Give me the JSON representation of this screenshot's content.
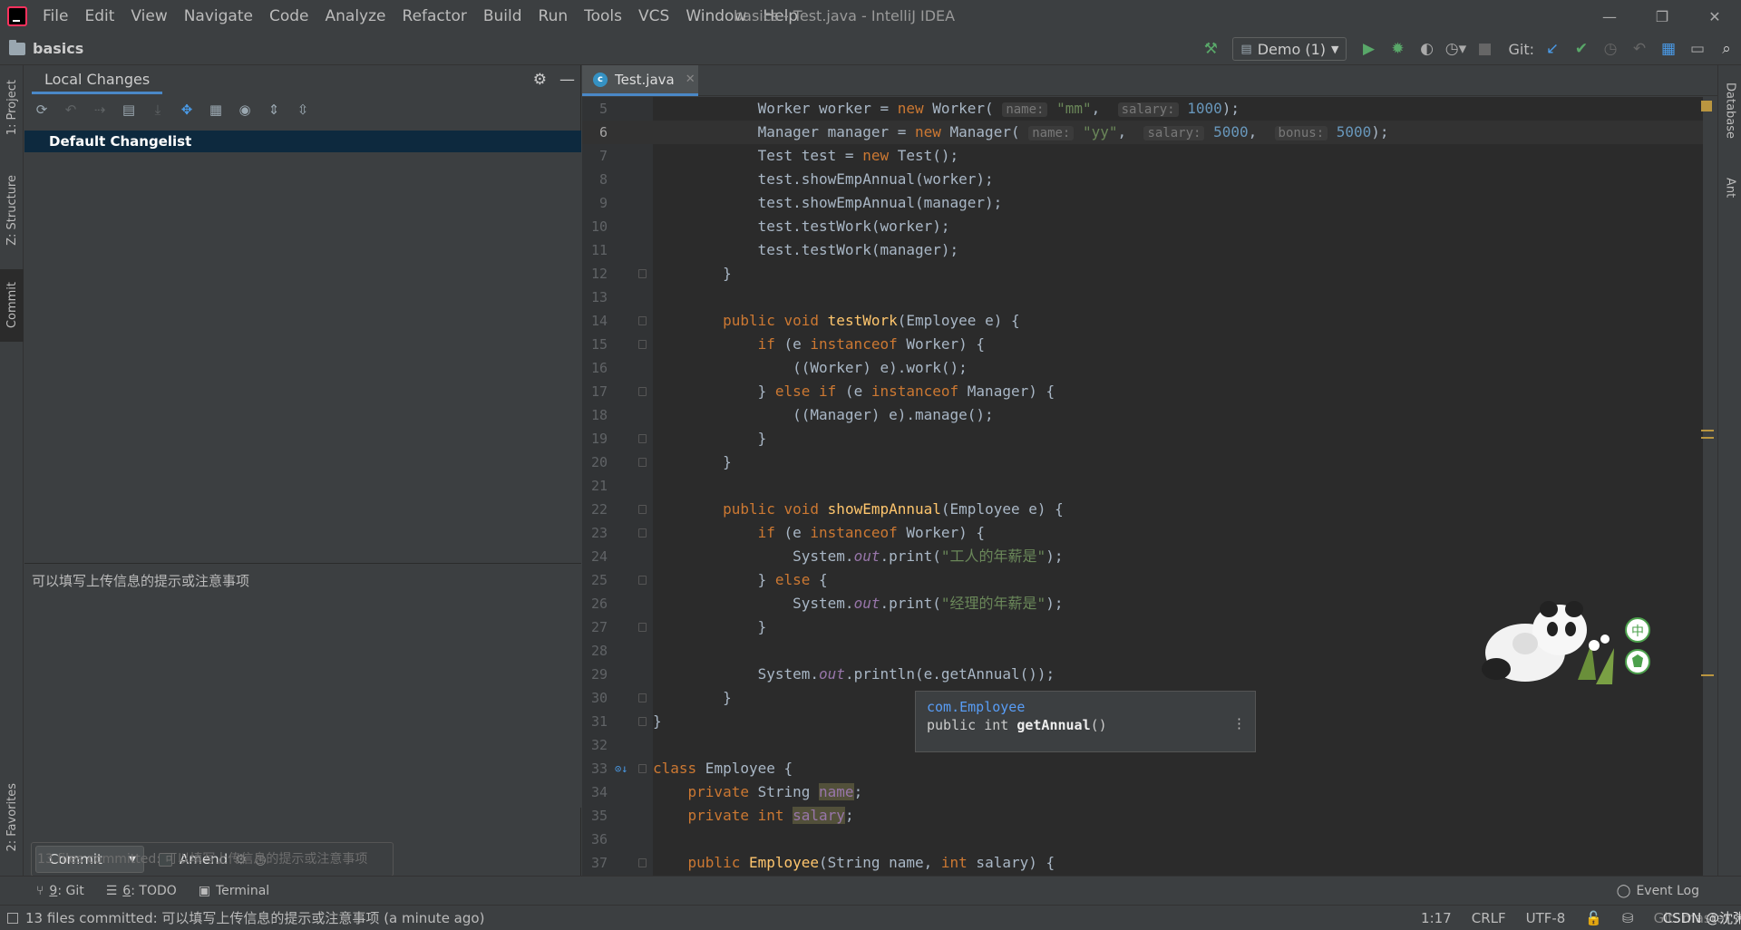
{
  "window": {
    "title": "basics - Test.java - IntelliJ IDEA",
    "menu": [
      "File",
      "Edit",
      "View",
      "Navigate",
      "Code",
      "Analyze",
      "Refactor",
      "Build",
      "Run",
      "Tools",
      "VCS",
      "Window",
      "Help"
    ]
  },
  "navbar": {
    "project": "basics",
    "run_config": "Demo (1)",
    "git_label": "Git:"
  },
  "left_stripe": {
    "project": "1: Project",
    "structure": "Z: Structure",
    "commit": "Commit",
    "favorites": "2: Favorites"
  },
  "right_stripe": {
    "database": "Database",
    "ant": "Ant"
  },
  "tool_window": {
    "tab": "Local Changes",
    "changelist": "Default Changelist",
    "commit_message": "可以填写上传信息的提示或注意事项",
    "commit_button": "Commit",
    "amend_label": "Amend",
    "ghost_text": "13 files committed: 可以填写上传信息的提示或注意事项"
  },
  "editor": {
    "tab": "Test.java",
    "lines": [
      5,
      6,
      7,
      8,
      9,
      10,
      11,
      12,
      13,
      14,
      15,
      16,
      17,
      18,
      19,
      20,
      21,
      22,
      23,
      24,
      25,
      26,
      27,
      28,
      29,
      30,
      31,
      32,
      33,
      34,
      35,
      36,
      37
    ]
  },
  "popup": {
    "class": "com.Employee",
    "signature_prefix": "public int ",
    "method": "getAnnual",
    "signature_suffix": "()"
  },
  "bottom_tabs": [
    {
      "num": "9",
      "label": ": Git"
    },
    {
      "num": "6",
      "label": ": TODO"
    },
    {
      "num": "",
      "label": "Terminal"
    }
  ],
  "event_log": "Event Log",
  "status": {
    "message": "13 files committed: 可以填写上传信息的提示或注意事项 (a minute ago)",
    "position": "1:17",
    "line_sep": "CRLF",
    "encoding": "UTF-8",
    "branch": "Git: master",
    "watermark": "CSDN @沈粥粥"
  },
  "colors": {
    "keyword": "#cc7832",
    "string": "#6a8759",
    "number": "#6897bb",
    "function": "#ffc66d",
    "accent": "#4a88c7"
  }
}
